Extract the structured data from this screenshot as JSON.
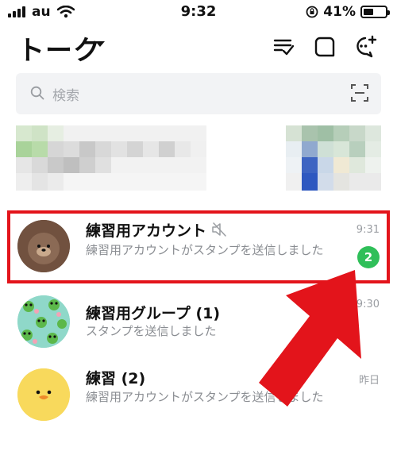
{
  "status_bar": {
    "carrier": "au",
    "time": "9:32",
    "battery_percent": "41%"
  },
  "header": {
    "title": "トーク",
    "icons": [
      "sort-edit-icon",
      "new-chat-icon",
      "add-chat-icon"
    ]
  },
  "search": {
    "placeholder": "検索",
    "icon": "search-icon",
    "scan_icon": "qr-scan-icon"
  },
  "chats": [
    {
      "name": "練習用アカウント",
      "muted": true,
      "message": "練習用アカウントがスタンプを送信しました",
      "time": "9:31",
      "unread": "2"
    },
    {
      "name": "練習用グループ (1)",
      "muted": false,
      "message": "スタンプを送信しました",
      "time": "9:30",
      "unread": ""
    },
    {
      "name": "練習 (2)",
      "muted": false,
      "message": "練習用アカウントがスタンプを送信しました",
      "time": "昨日",
      "unread": ""
    }
  ],
  "colors": {
    "unread_badge": "#2fbf59",
    "highlight": "#e3141b",
    "search_bg": "#f2f3f5"
  }
}
